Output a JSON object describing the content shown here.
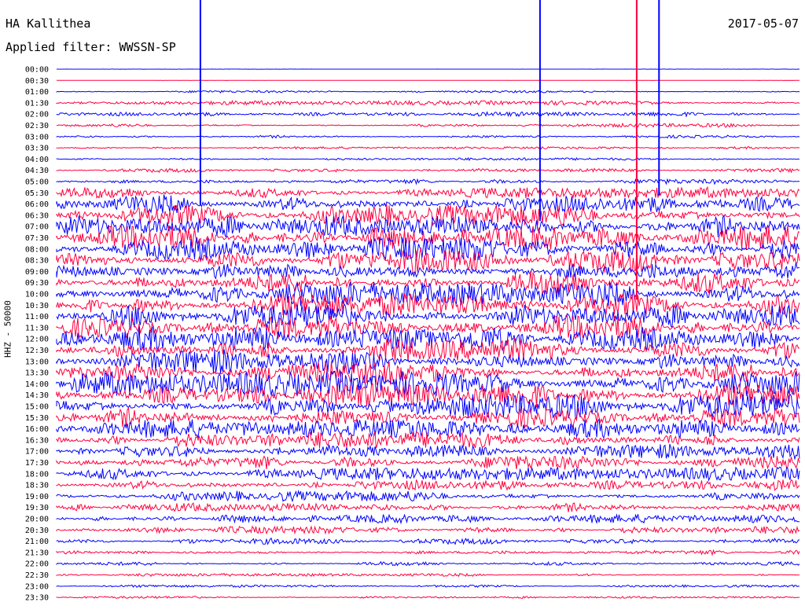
{
  "header": {
    "station": "HA Kallithea",
    "filter": "Applied filter: WWSSN-SP",
    "date": "2017-05-07"
  },
  "colors": {
    "trace_a": "#0000ff",
    "trace_b": "#ff0040",
    "background": "#ffffff"
  },
  "chart_data": {
    "type": "line",
    "title": "HA Kallithea",
    "subtitle": "Applied filter: WWSSN-SP",
    "date": "2017-05-07",
    "ylabel": "HHZ - 50000",
    "tick_labels": [
      "00:00",
      "00:30",
      "01:00",
      "01:30",
      "02:00",
      "02:30",
      "03:00",
      "03:30",
      "04:00",
      "04:30",
      "05:00",
      "05:30",
      "06:00",
      "06:30",
      "07:00",
      "07:30",
      "08:00",
      "08:30",
      "09:00",
      "09:30",
      "10:00",
      "10:30",
      "11:00",
      "11:30",
      "12:00",
      "12:30",
      "13:00",
      "13:30",
      "14:00",
      "14:30",
      "15:00",
      "15:30",
      "16:00",
      "16:30",
      "17:00",
      "17:30",
      "18:00",
      "18:30",
      "19:00",
      "19:30",
      "20:00",
      "20:30",
      "21:00",
      "21:30",
      "22:00",
      "22:30",
      "23:00",
      "23:30"
    ],
    "row_minutes": 30,
    "series_colors_alternating": [
      "#0000ff",
      "#ff0040"
    ],
    "relative_amplitude_per_row": [
      0.05,
      0.03,
      0.45,
      0.85,
      0.9,
      0.75,
      0.6,
      0.45,
      0.5,
      0.8,
      1.0,
      2.2,
      4.0,
      4.5,
      4.8,
      5.0,
      5.0,
      5.0,
      5.0,
      5.0,
      5.0,
      5.0,
      5.0,
      5.0,
      5.0,
      5.0,
      5.0,
      5.0,
      5.0,
      5.0,
      5.0,
      4.2,
      3.8,
      3.4,
      3.0,
      2.8,
      2.6,
      2.4,
      2.2,
      2.0,
      1.8,
      1.5,
      1.2,
      1.0,
      0.8,
      0.6,
      0.5,
      0.45
    ],
    "spikes": [
      {
        "time": "01:00",
        "minute_in_row": 5.8,
        "relative_height": 4.5
      },
      {
        "time": "00:00",
        "minute_in_row": 19.5,
        "relative_height": 6.0
      },
      {
        "time": "00:00",
        "minute_in_row": 24.3,
        "relative_height": 5.0
      },
      {
        "time": "03:30",
        "minute_in_row": 23.4,
        "relative_height": 6.0
      }
    ],
    "grid": false
  }
}
